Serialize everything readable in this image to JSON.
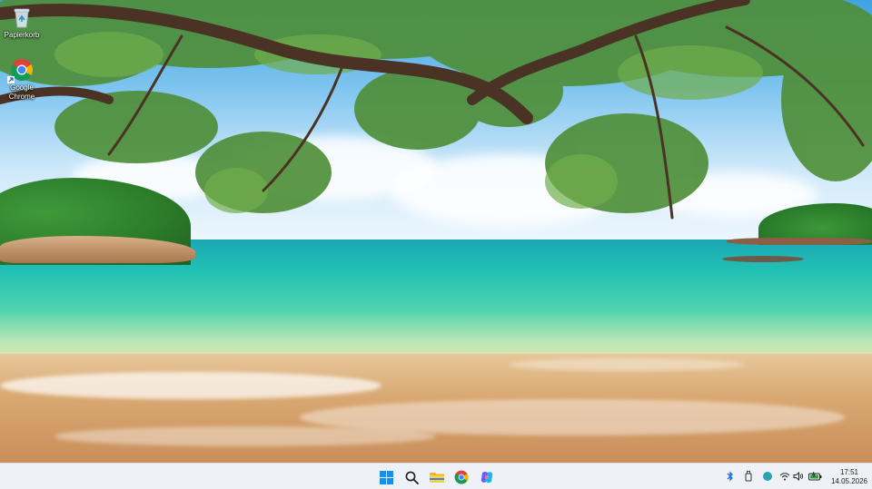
{
  "desktop": {
    "icons": [
      {
        "label": "Papierkorb",
        "icon": "recycle-bin-icon"
      },
      {
        "label": "Google Chrome",
        "icon": "chrome-icon"
      }
    ]
  },
  "taskbar": {
    "pinned": [
      {
        "name": "start",
        "icon": "windows-start-icon"
      },
      {
        "name": "search",
        "icon": "search-icon"
      },
      {
        "name": "file-explorer",
        "icon": "folder-icon"
      },
      {
        "name": "chrome",
        "icon": "chrome-icon"
      },
      {
        "name": "copilot",
        "icon": "copilot-icon"
      }
    ],
    "tray": [
      {
        "name": "bluetooth",
        "icon": "bluetooth-icon"
      },
      {
        "name": "usb",
        "icon": "usb-drive-icon"
      },
      {
        "name": "network-globe",
        "icon": "globe-icon"
      },
      {
        "name": "wifi",
        "icon": "wifi-icon"
      },
      {
        "name": "volume",
        "icon": "speaker-icon"
      },
      {
        "name": "battery",
        "icon": "battery-icon"
      }
    ],
    "clock": {
      "time": "17:51",
      "date": "14.05.2026"
    }
  },
  "colors": {
    "accent": "#0078d4",
    "taskbar_bg": "#eef1f6"
  }
}
